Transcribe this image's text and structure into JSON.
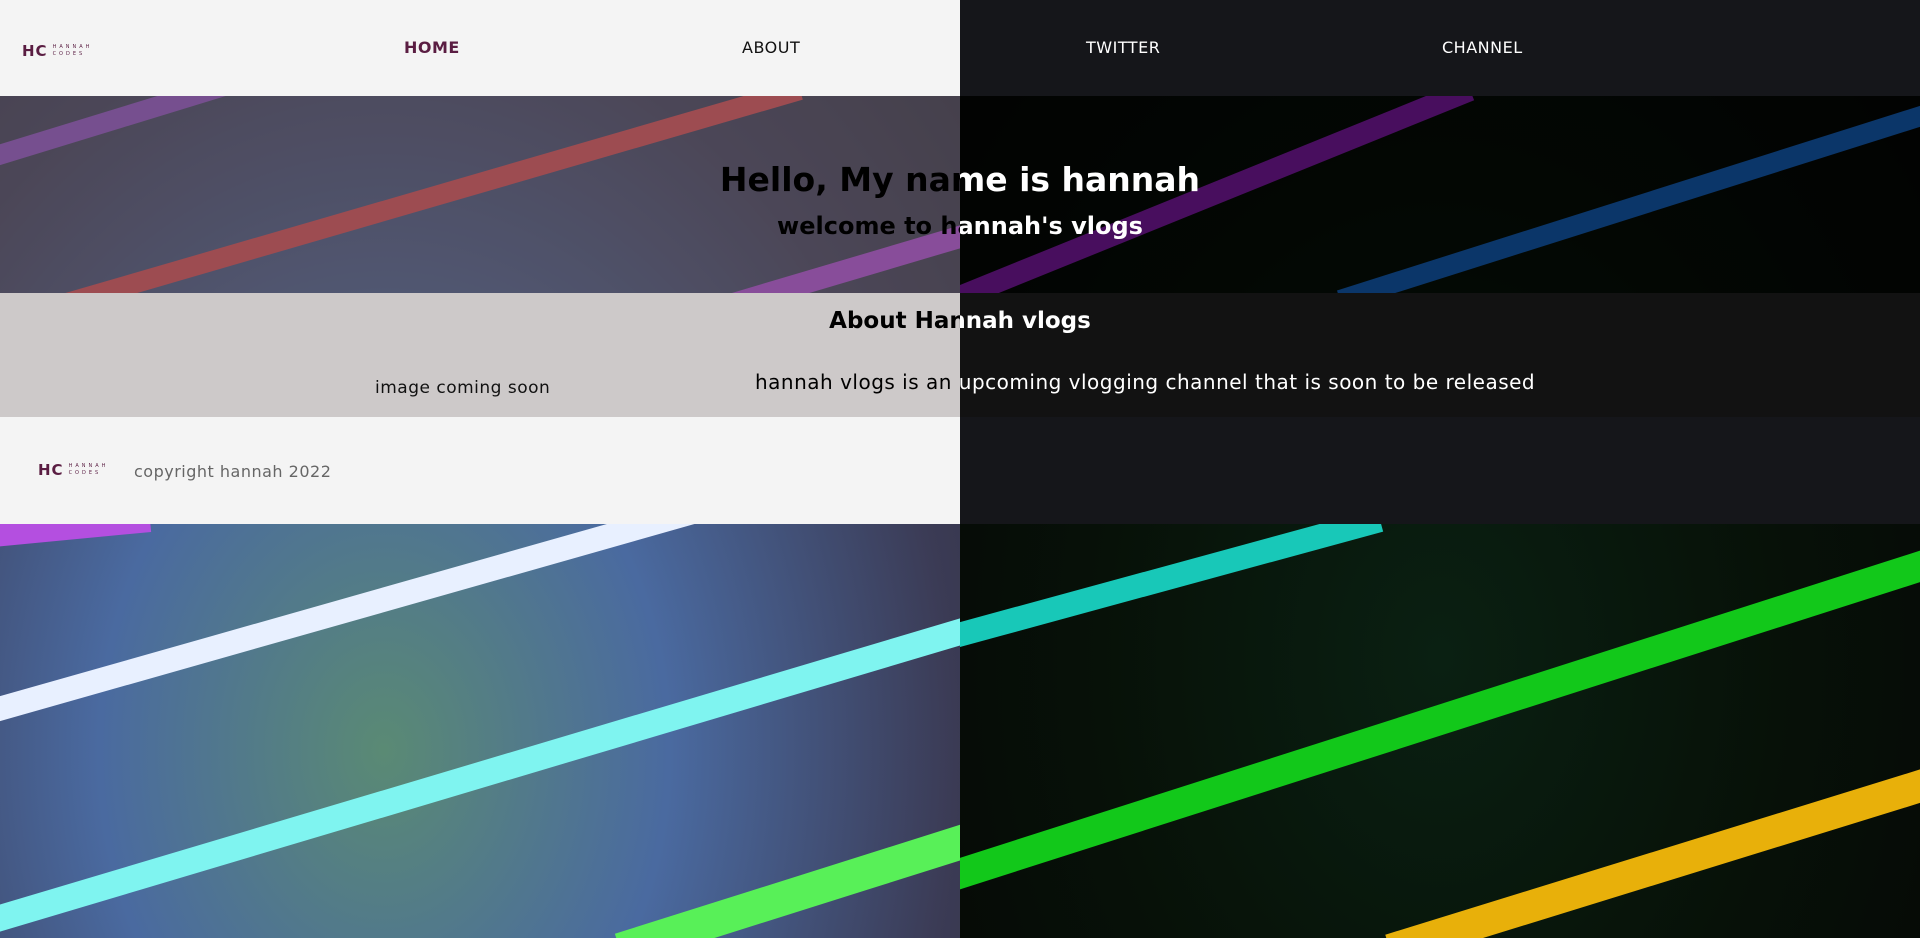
{
  "header": {
    "logo": {
      "mark": "HC",
      "line1": "HANNAH",
      "line2": "CODES"
    },
    "nav": [
      {
        "label": "HOME",
        "active": true
      },
      {
        "label": "ABOUT",
        "active": false
      },
      {
        "label": "TWITTER",
        "active": false
      },
      {
        "label": "CHANNEL",
        "active": false
      }
    ]
  },
  "hero": {
    "title": "Hello, My name is hannah",
    "subtitle": "welcome to hannah's vlogs"
  },
  "about": {
    "heading": "About Hannah vlogs",
    "image_placeholder": "image coming soon",
    "description": "hannah vlogs is an upcoming vlogging channel that is soon to be released"
  },
  "footer": {
    "logo": {
      "mark": "HC",
      "line1": "HANNAH",
      "line2": "CODES"
    },
    "copyright": "copyright hannah 2022"
  },
  "colors": {
    "brand": "#5a1d42",
    "light_panel": "#f4f4f4",
    "dark_panel": "#15161a",
    "about_light": "#cdc9c9",
    "about_dark": "#121212"
  }
}
